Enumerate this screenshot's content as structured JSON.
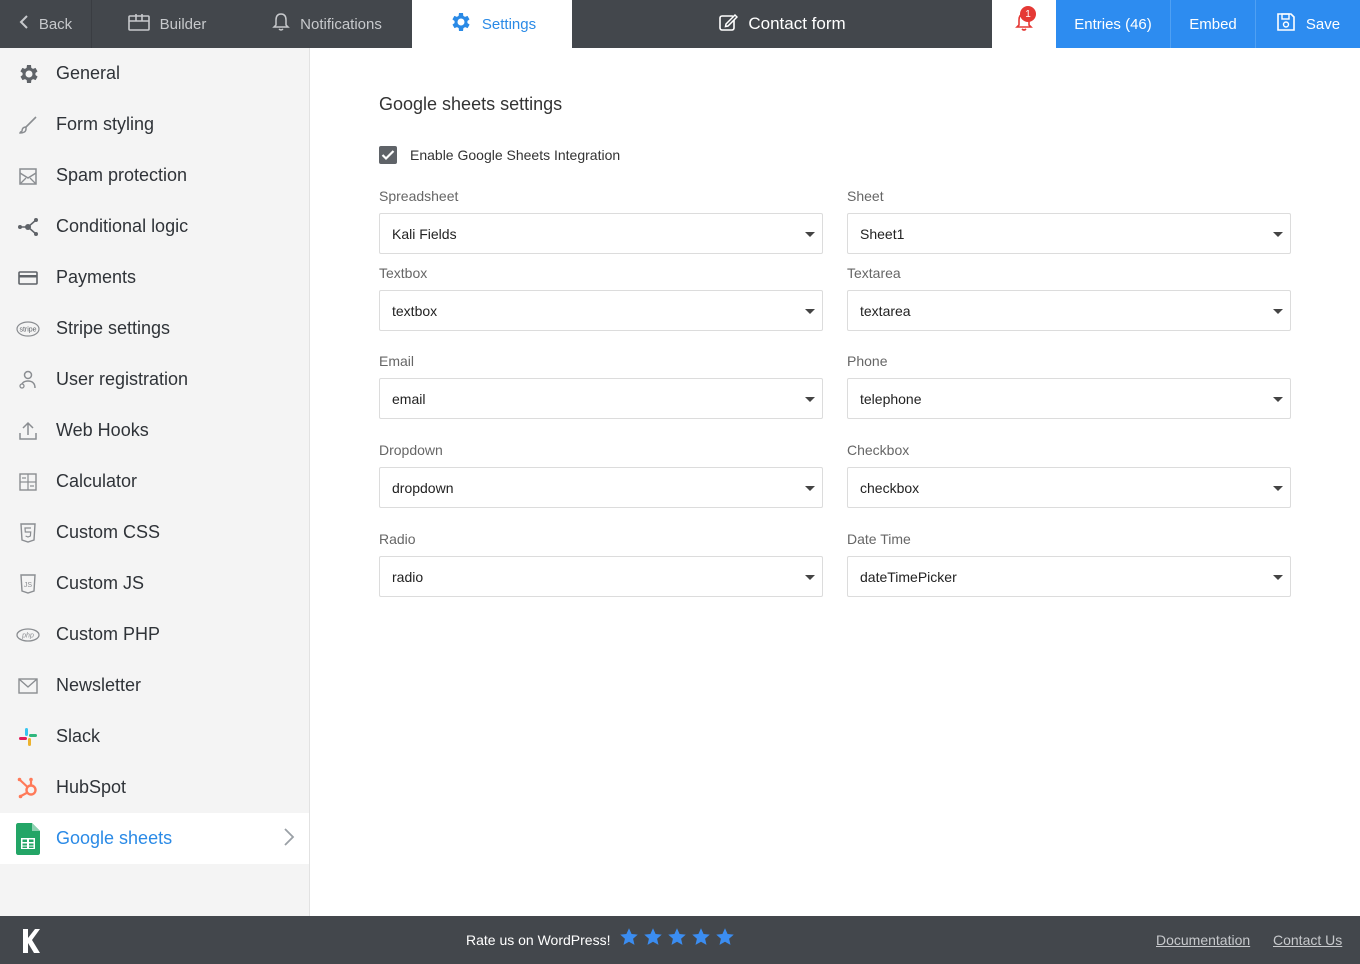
{
  "topbar": {
    "back": "Back",
    "builder": "Builder",
    "notifications": "Notifications",
    "settings": "Settings",
    "form_title": "Contact form",
    "bell_badge": "1",
    "entries": "Entries (46)",
    "embed": "Embed",
    "save": "Save"
  },
  "sidebar": {
    "items": [
      {
        "label": "General",
        "icon": "gear-icon"
      },
      {
        "label": "Form styling",
        "icon": "brush-icon"
      },
      {
        "label": "Spam protection",
        "icon": "shield-envelope-icon"
      },
      {
        "label": "Conditional logic",
        "icon": "branch-icon"
      },
      {
        "label": "Payments",
        "icon": "credit-card-icon"
      },
      {
        "label": "Stripe settings",
        "icon": "stripe-icon"
      },
      {
        "label": "User registration",
        "icon": "user-icon"
      },
      {
        "label": "Web Hooks",
        "icon": "upload-icon"
      },
      {
        "label": "Calculator",
        "icon": "calculator-icon"
      },
      {
        "label": "Custom CSS",
        "icon": "css-icon"
      },
      {
        "label": "Custom JS",
        "icon": "js-icon"
      },
      {
        "label": "Custom PHP",
        "icon": "php-icon"
      },
      {
        "label": "Newsletter",
        "icon": "envelope-icon"
      },
      {
        "label": "Slack",
        "icon": "slack-icon"
      },
      {
        "label": "HubSpot",
        "icon": "hubspot-icon"
      },
      {
        "label": "Google sheets",
        "icon": "google-sheets-icon"
      }
    ],
    "active_index": 15
  },
  "main": {
    "title": "Google sheets settings",
    "enable_label": "Enable Google Sheets Integration",
    "enable_checked": true,
    "fields": [
      {
        "label": "Spreadsheet",
        "value": "Kali Fields"
      },
      {
        "label": "Sheet",
        "value": "Sheet1"
      },
      {
        "label": "Textbox",
        "value": "textbox"
      },
      {
        "label": "Textarea",
        "value": "textarea"
      },
      {
        "label": "Email",
        "value": "email"
      },
      {
        "label": "Phone",
        "value": "telephone"
      },
      {
        "label": "Dropdown",
        "value": "dropdown"
      },
      {
        "label": "Checkbox",
        "value": "checkbox"
      },
      {
        "label": "Radio",
        "value": "radio"
      },
      {
        "label": "Date Time",
        "value": "dateTimePicker"
      }
    ]
  },
  "footer": {
    "rate_text": "Rate us on WordPress!",
    "stars": 5,
    "documentation": "Documentation",
    "contact": "Contact Us"
  },
  "colors": {
    "accent": "#2a8ae6",
    "topbar": "#43474c",
    "button": "#2d8cf0",
    "badge": "#e53935",
    "sheets_green": "#23a566",
    "hubspot_orange": "#ff7a59"
  }
}
